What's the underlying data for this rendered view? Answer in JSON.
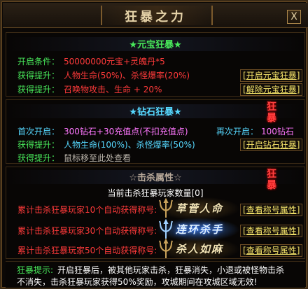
{
  "window": {
    "title": "狂暴之力",
    "close_label": "X"
  },
  "yuanbao": {
    "header": "★元宝狂暴★",
    "rows": [
      {
        "label": "开启条件：",
        "value": "50000000元宝+灵魄丹*5"
      },
      {
        "label": "获得提升：",
        "value": "人物生命(50%)、杀怪爆率(20%)"
      },
      {
        "label": "获得提升：",
        "value": "召唤物攻击、生命 + 20%"
      }
    ],
    "open_link": "开启元宝狂暴",
    "close_link": "解除元宝狂暴"
  },
  "diamond": {
    "header": "★钻石狂暴★",
    "rows": [
      {
        "label": "首次开启：",
        "value": "300钻石+30充值点(不扣充值点)"
      },
      {
        "label": "获得提升：",
        "value": "人物生命(100%)、杀怪爆率(50%)"
      },
      {
        "label": "获得提升：",
        "value": "鼠标移至此处查看"
      }
    ],
    "again_label": "再次开启：",
    "again_value": "100钻石",
    "open_link": "开启钻石狂暴",
    "seal_text": [
      "狂",
      "暴"
    ]
  },
  "kill": {
    "header": "☆击杀属性☆",
    "current_count": "当前击杀狂暴玩家数量[0]",
    "rows": [
      {
        "text": "累计击杀狂暴玩家10个自动获得称号:",
        "title": "草菅人命",
        "link": "查看称号属性"
      },
      {
        "text": "累计击杀狂暴玩家30个自动获得称号:",
        "title": "连环杀手",
        "link": "查看称号属性"
      },
      {
        "text": "累计击杀狂暴玩家50个自动获得称号:",
        "title": "杀人如麻",
        "link": "查看称号属性"
      }
    ],
    "seal_text": [
      "狂",
      "暴"
    ]
  },
  "tips": {
    "label": "狂暴提示:",
    "line1": "开启狂暴后，被其他玩家击杀，狂暴消失，小退或被怪物击杀",
    "line2": "不消失，击杀狂暴玩家获得50%奖励，攻城期间在攻城区域无效!"
  },
  "colors": {
    "label_green": "#48e85a",
    "value_red": "#ff3a3a",
    "link_gold": "#f5e46a",
    "cyan": "#56d8ff",
    "pink": "#ff77ff"
  }
}
